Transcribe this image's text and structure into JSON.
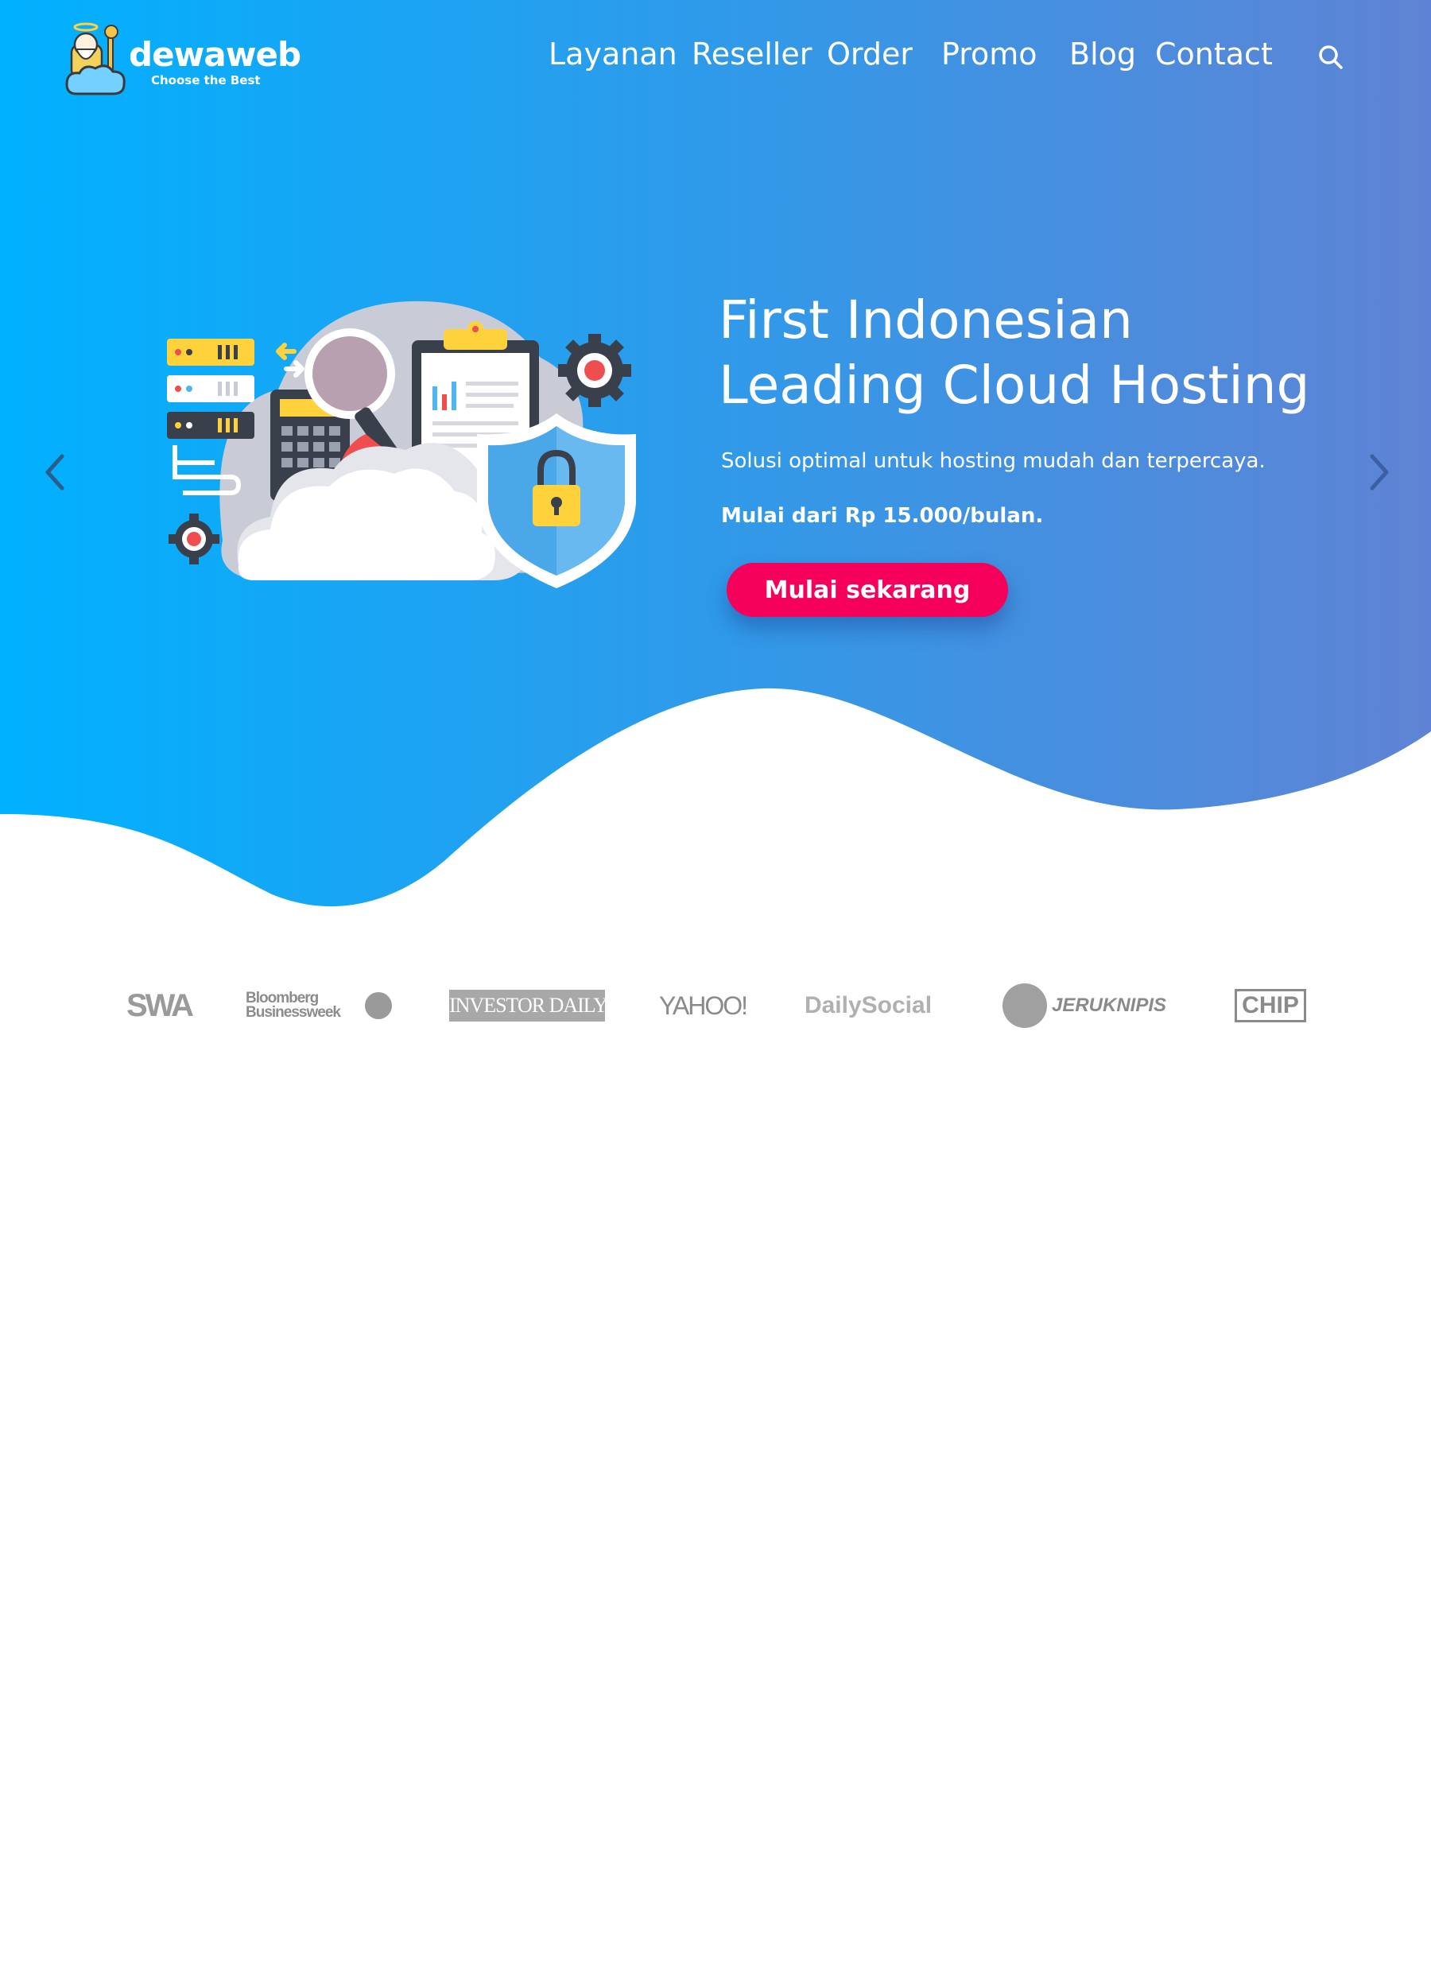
{
  "brand": {
    "name": "dewaweb",
    "tagline": "Choose the Best"
  },
  "nav": {
    "items": [
      {
        "label": "Layanan"
      },
      {
        "label": "Reseller"
      },
      {
        "label": "Order"
      },
      {
        "label": "Promo"
      },
      {
        "label": "Blog"
      },
      {
        "label": "Contact"
      }
    ],
    "search_icon": "search-icon"
  },
  "hero": {
    "title_line1": "First Indonesian",
    "title_line2": "Leading Cloud Hosting",
    "subtitle": "Solusi optimal untuk hosting mudah dan terpercaya.",
    "price": "Mulai dari Rp 15.000/bulan.",
    "cta_label": "Mulai sekarang",
    "prev_icon": "chevron-left-icon",
    "next_icon": "chevron-right-icon"
  },
  "press": {
    "logos": [
      {
        "name": "SWA"
      },
      {
        "name": "Bloomberg Businessweek"
      },
      {
        "name": "INVESTOR DAILY"
      },
      {
        "name": "YAHOO!"
      },
      {
        "name": "DailySocial"
      },
      {
        "name": "JERUKNIPIS"
      },
      {
        "name": "CHIP"
      }
    ]
  },
  "colors": {
    "gradient_start": "#00b1ff",
    "gradient_end": "#5f83d4",
    "cta": "#f5005a",
    "text_light": "#ffffff",
    "press_gray": "#9a9a9a"
  }
}
